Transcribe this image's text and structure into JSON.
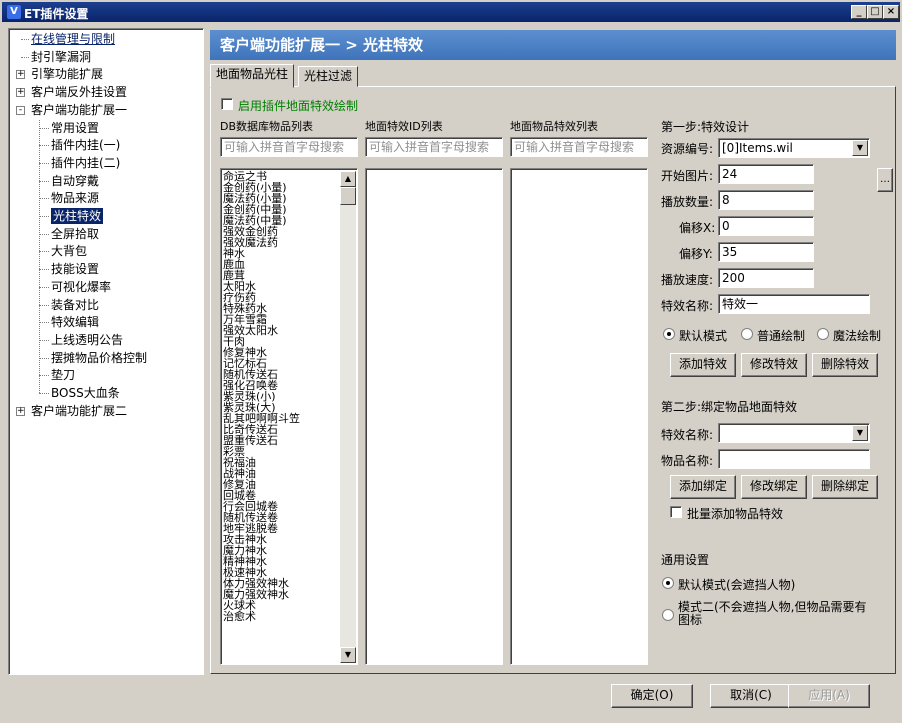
{
  "window": {
    "title": "ET插件设置",
    "logo": "V",
    "buttons": [
      "_",
      "□",
      "×"
    ]
  },
  "tree": {
    "items": [
      {
        "label": "在线管理与限制",
        "level": 0,
        "selected": false
      },
      {
        "label": "封引擎漏洞",
        "level": 0,
        "selected": false
      },
      {
        "label": "引擎功能扩展",
        "level": 0,
        "expander": "+"
      },
      {
        "label": "客户端反外挂设置",
        "level": 0,
        "expander": "+"
      },
      {
        "label": "客户端功能扩展一",
        "level": 0,
        "expander": "-"
      },
      {
        "label": "常用设置",
        "level": 1
      },
      {
        "label": "插件内挂(一)",
        "level": 1
      },
      {
        "label": "插件内挂(二)",
        "level": 1
      },
      {
        "label": "自动穿戴",
        "level": 1
      },
      {
        "label": "物品来源",
        "level": 1
      },
      {
        "label": "光柱特效",
        "level": 1,
        "selected": true
      },
      {
        "label": "全屏拾取",
        "level": 1
      },
      {
        "label": "大背包",
        "level": 1
      },
      {
        "label": "技能设置",
        "level": 1
      },
      {
        "label": "可视化爆率",
        "level": 1
      },
      {
        "label": "装备对比",
        "level": 1
      },
      {
        "label": "特效编辑",
        "level": 1
      },
      {
        "label": "上线透明公告",
        "level": 1
      },
      {
        "label": "摆摊物品价格控制",
        "level": 1
      },
      {
        "label": "垫刀",
        "level": 1
      },
      {
        "label": "BOSS大血条",
        "level": 1
      },
      {
        "label": "客户端功能扩展二",
        "level": 0,
        "expander": "+"
      }
    ]
  },
  "header": {
    "title": "客户端功能扩展一 > 光柱特效"
  },
  "tabs": [
    {
      "label": "地面物品光柱",
      "active": true
    },
    {
      "label": "光柱过滤",
      "active": false
    }
  ],
  "enable_checkbox": {
    "label": "启用插件地面特效绘制",
    "checked": false
  },
  "columns": {
    "db": {
      "header": "DB数据库物品列表",
      "placeholder": "可输入拼音首字母搜索"
    },
    "ids": {
      "header": "地面特效ID列表",
      "placeholder": "可输入拼音首字母搜索"
    },
    "effects": {
      "header": "地面物品特效列表",
      "placeholder": "可输入拼音首字母搜索"
    }
  },
  "db_items": [
    "命运之书",
    "金创药(小量)",
    "魔法药(小量)",
    "金创药(中量)",
    "魔法药(中量)",
    "强效金创药",
    "强效魔法药",
    "神水",
    "鹿血",
    "鹿茸",
    "太阳水",
    "疗伤药",
    "特殊药水",
    "万年雪霜",
    "强效太阳水",
    "干肉",
    "修复神水",
    "记忆标石",
    "随机传送石",
    "强化召唤卷",
    "紫灵珠(小)",
    "紫灵珠(大)",
    "乱其吧啊啊斗笠",
    "比奇传送石",
    "盟重传送石",
    "彩票",
    "祝福油",
    "战神油",
    "修复油",
    "回城卷",
    "行会回城卷",
    "随机传送卷",
    "地牢逃脱卷",
    "攻击神水",
    "魔力神水",
    "精神神水",
    "极速神水",
    "体力强效神水",
    "魔力强效神水",
    "火球术",
    "治愈术"
  ],
  "step1": {
    "title": "第一步:特效设计",
    "resource_label": "资源编号:",
    "resource_value": "[0]Items.wil",
    "start_label": "开始图片:",
    "start_value": "24",
    "count_label": "播放数量:",
    "count_value": "8",
    "offx_label": "偏移X:",
    "offx_value": "0",
    "offy_label": "偏移Y:",
    "offy_value": "35",
    "speed_label": "播放速度:",
    "speed_value": "200",
    "name_label": "特效名称:",
    "name_value": "特效一",
    "modes": [
      {
        "label": "默认模式",
        "checked": true
      },
      {
        "label": "普通绘制",
        "checked": false
      },
      {
        "label": "魔法绘制",
        "checked": false
      }
    ],
    "add": "添加特效",
    "modify": "修改特效",
    "delete": "删除特效"
  },
  "step2": {
    "title": "第二步:绑定物品地面特效",
    "effect_label": "特效名称:",
    "effect_value": "",
    "item_label": "物品名称:",
    "item_value": "",
    "add": "添加绑定",
    "modify": "修改绑定",
    "delete": "删除绑定",
    "batch_label": "批量添加物品特效",
    "batch_checked": false
  },
  "general": {
    "title": "通用设置",
    "mode1": "默认模式(会遮挡人物)",
    "mode2": "模式二(不会遮挡人物,但物品需要有图标"
  },
  "footer": {
    "ok": "确定(O)",
    "cancel": "取消(C)",
    "apply": "应用(A)"
  }
}
